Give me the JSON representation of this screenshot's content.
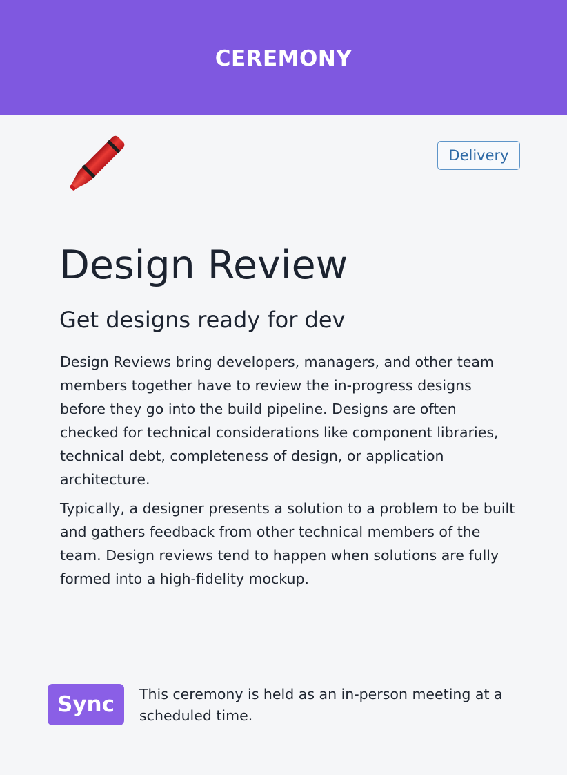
{
  "header": {
    "title": "CEREMONY",
    "background_color": "#7f58e0"
  },
  "card": {
    "icon": "crayon-icon",
    "tag": "Delivery",
    "title": "Design Review",
    "subtitle": "Get designs ready for dev",
    "paragraphs": [
      "Design Reviews bring developers, managers, and other team members together have to review the in-progress designs before they go into the build pipeline. Designs are often checked for technical considerations like component libraries, technical debt, completeness of design, or application architecture.",
      "Typically, a designer presents a solution to a problem to be built and gathers feedback from other technical members of the team. Design reviews tend to happen when solutions are fully formed into a high-fidelity mockup."
    ]
  },
  "footer": {
    "badge": "Sync",
    "badge_color": "#8a5fe6",
    "description": "This ceremony is held as an in-person meeting at a scheduled time."
  }
}
